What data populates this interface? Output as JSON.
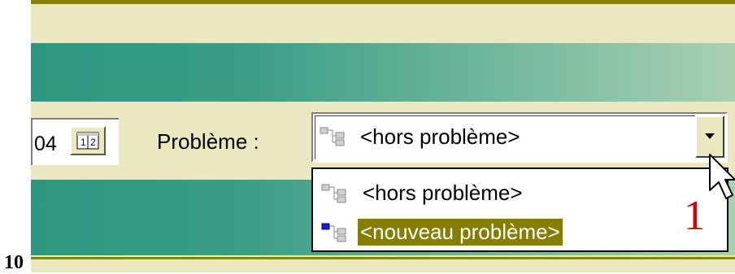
{
  "year_field": {
    "value": "04"
  },
  "calendar_button": {
    "icon": "calendar-icon"
  },
  "problem_label": "Problème :",
  "combo": {
    "selected_value": "<hors problème>",
    "icon": "tree-structure-icon",
    "arrow_icon": "chevron-down-icon"
  },
  "dropdown": {
    "options": [
      {
        "label": "<hors problème>",
        "icon": "tree-structure-icon",
        "selected": false
      },
      {
        "label": "<nouveau problème>",
        "icon": "tree-structure-new-icon",
        "selected": true
      }
    ]
  },
  "annotation": {
    "step": "1",
    "color": "#d00000"
  },
  "page_number": "10",
  "colors": {
    "accent_olive": "#868300",
    "panel_beige": "#e9e8c1",
    "teal": "#2d9780",
    "selection": "#857e00"
  }
}
